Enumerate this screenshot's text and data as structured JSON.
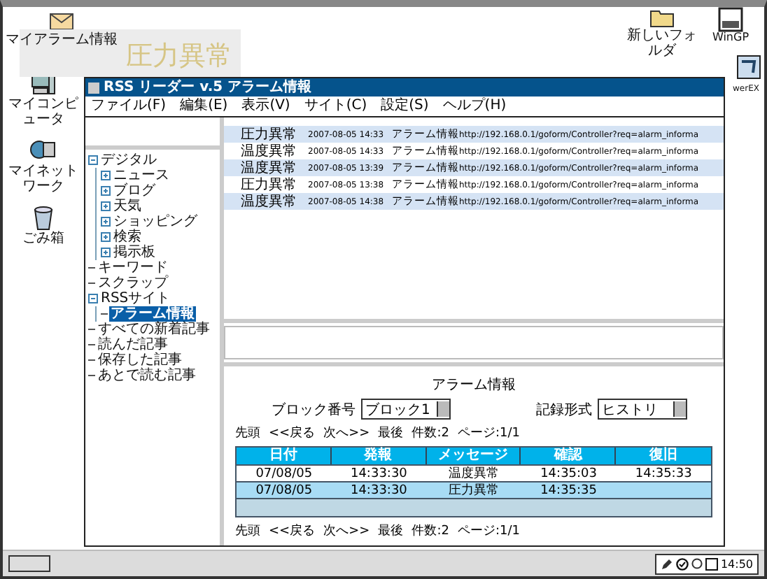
{
  "desktop_icons": [
    {
      "label": "マイアラーム情報",
      "kind": "mail"
    },
    {
      "label": "マイコンピュータ",
      "kind": "computer"
    },
    {
      "label": "マイネットワーク",
      "kind": "network"
    },
    {
      "label": "ごみ箱",
      "kind": "trash"
    },
    {
      "label": "新しいフォルダ",
      "kind": "folder"
    },
    {
      "label": "WinGP",
      "kind": "app"
    },
    {
      "label": "werEX",
      "kind": "tool"
    }
  ],
  "alarm_popup": {
    "message": "圧力異常"
  },
  "window": {
    "title": "RSS リーダー v.5 アラーム情報",
    "menu": [
      "ファイル(F)",
      "編集(E)",
      "表示(V)",
      "サイト(C)",
      "設定(S)",
      "ヘルプ(H)"
    ],
    "tree": [
      {
        "label": "デジタル",
        "expanded": true,
        "selected": false,
        "children": [
          {
            "label": "ニュース",
            "expanded": false,
            "selected": false
          },
          {
            "label": "ブログ",
            "expanded": false,
            "selected": false
          },
          {
            "label": "天気",
            "expanded": false,
            "selected": false
          },
          {
            "label": "ショッピング",
            "expanded": false,
            "selected": false
          },
          {
            "label": "検索",
            "expanded": false,
            "selected": false
          },
          {
            "label": "掲示板",
            "expanded": false,
            "selected": false
          }
        ]
      },
      {
        "label": "キーワード",
        "selected": false
      },
      {
        "label": "スクラップ",
        "selected": false
      },
      {
        "label": "RSSサイト",
        "expanded": true,
        "selected": false,
        "children": [
          {
            "label": "アラーム情報",
            "selected": true
          }
        ]
      },
      {
        "label": "すべての新着記事",
        "selected": false
      },
      {
        "label": "読んだ記事",
        "selected": false
      },
      {
        "label": "保存した記事",
        "selected": false
      },
      {
        "label": "あとで読む記事",
        "selected": false
      }
    ],
    "feed_items": [
      {
        "title": "圧力異常",
        "date": "2007-08-05 14:33",
        "source": "アラーム情報",
        "url": "http://192.168.0.1/goform/Controller?req=alarm_informa"
      },
      {
        "title": "温度異常",
        "date": "2007-08-05 14:33",
        "source": "アラーム情報",
        "url": "http://192.168.0.1/goform/Controller?req=alarm_informa"
      },
      {
        "title": "温度異常",
        "date": "2007-08-05 13:39",
        "source": "アラーム情報",
        "url": "http://192.168.0.1/goform/Controller?req=alarm_informa"
      },
      {
        "title": "圧力異常",
        "date": "2007-08-05 13:38",
        "source": "アラーム情報",
        "url": "http://192.168.0.1/goform/Controller?req=alarm_informa"
      },
      {
        "title": "温度異常",
        "date": "2007-08-05 14:38",
        "source": "アラーム情報",
        "url": "http://192.168.0.1/goform/Controller?req=alarm_informa"
      }
    ],
    "detail": {
      "title": "アラーム情報",
      "block": {
        "label": "ブロック番号",
        "value": "ブロック1"
      },
      "record_format": {
        "label": "記録形式",
        "value": "ヒストリ"
      },
      "pager_top": [
        "先頭",
        "<<戻る",
        "次へ>>",
        "最後",
        "件数:2",
        "ページ:1/1"
      ],
      "table": {
        "columns": [
          "日付",
          "発報",
          "メッセージ",
          "確認",
          "復旧"
        ],
        "rows": [
          {
            "cells": [
              "07/08/05",
              "14:33:30",
              "温度異常",
              "14:35:03",
              "14:35:33"
            ],
            "selected": false
          },
          {
            "cells": [
              "07/08/05",
              "14:33:30",
              "圧力異常",
              "14:35:35",
              ""
            ],
            "selected": true
          }
        ]
      },
      "pager_bottom": [
        "先頭",
        "<<戻る",
        "次へ>>",
        "最後",
        "件数:2",
        "ページ:1/1"
      ]
    }
  },
  "taskbar": {
    "clock": "14:50"
  }
}
